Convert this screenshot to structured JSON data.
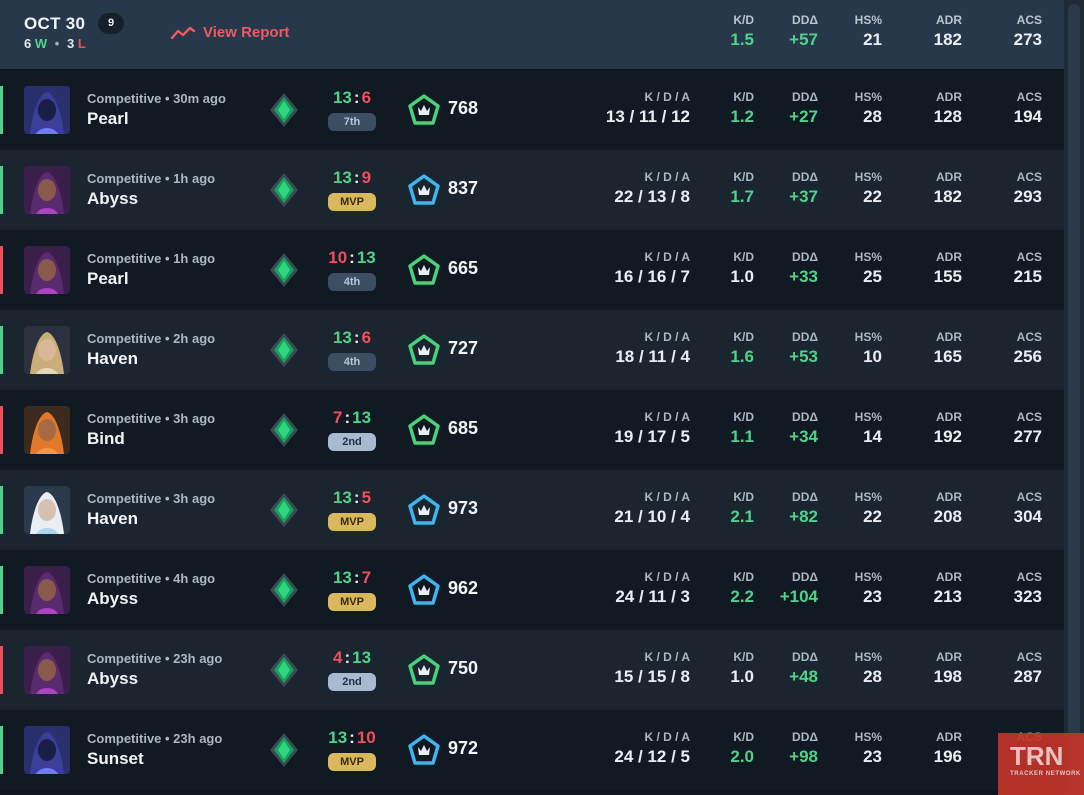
{
  "header": {
    "date": "OCT 30",
    "match_count": "9",
    "wins": "6",
    "wins_letter": "W",
    "losses": "3",
    "losses_letter": "L",
    "view_report": "View Report",
    "stats": [
      {
        "label": "K/D",
        "value": "1.5",
        "green": true
      },
      {
        "label": "DDΔ",
        "value": "+57",
        "green": true
      },
      {
        "label": "HS%",
        "value": "21",
        "green": false
      },
      {
        "label": "ADR",
        "value": "182",
        "green": false
      },
      {
        "label": "ACS",
        "value": "273",
        "green": false
      }
    ]
  },
  "column_labels": {
    "kda": "K / D / A",
    "kd": "K/D",
    "dd": "DDΔ",
    "hs": "HS%",
    "adr": "ADR",
    "acs": "ACS"
  },
  "matches": [
    {
      "result": "win",
      "agent": "omen-portrait",
      "meta": "Competitive • 30m ago",
      "map": "Pearl",
      "score_a": "13",
      "score_b": "6",
      "place": "7th",
      "place_style": "pos",
      "tier": "green",
      "rr": "768",
      "kda": "13 / 11 / 12",
      "kd": "1.2",
      "dd": "+27",
      "hs": "28",
      "adr": "128",
      "acs": "194"
    },
    {
      "result": "win",
      "agent": "reyna-portrait",
      "meta": "Competitive • 1h ago",
      "map": "Abyss",
      "score_a": "13",
      "score_b": "9",
      "place": "MVP",
      "place_style": "mvp",
      "tier": "blue",
      "rr": "837",
      "kda": "22 / 13 / 8",
      "kd": "1.7",
      "dd": "+37",
      "hs": "22",
      "adr": "182",
      "acs": "293"
    },
    {
      "result": "loss",
      "agent": "reyna-portrait",
      "meta": "Competitive • 1h ago",
      "map": "Pearl",
      "score_a": "10",
      "score_b": "13",
      "place": "4th",
      "place_style": "pos",
      "tier": "green",
      "rr": "665",
      "kda": "16 / 16 / 7",
      "kd": "1.0",
      "dd": "+33",
      "hs": "25",
      "adr": "155",
      "acs": "215"
    },
    {
      "result": "win",
      "agent": "chamber-portrait",
      "meta": "Competitive • 2h ago",
      "map": "Haven",
      "score_a": "13",
      "score_b": "6",
      "place": "4th",
      "place_style": "pos",
      "tier": "green",
      "rr": "727",
      "kda": "18 / 11 / 4",
      "kd": "1.6",
      "dd": "+53",
      "hs": "10",
      "adr": "165",
      "acs": "256"
    },
    {
      "result": "loss",
      "agent": "raze-portrait",
      "meta": "Competitive • 3h ago",
      "map": "Bind",
      "score_a": "7",
      "score_b": "13",
      "place": "2nd",
      "place_style": "pos2",
      "tier": "green",
      "rr": "685",
      "kda": "19 / 17 / 5",
      "kd": "1.1",
      "dd": "+34",
      "hs": "14",
      "adr": "192",
      "acs": "277"
    },
    {
      "result": "win",
      "agent": "jett-portrait",
      "meta": "Competitive • 3h ago",
      "map": "Haven",
      "score_a": "13",
      "score_b": "5",
      "place": "MVP",
      "place_style": "mvp",
      "tier": "blue",
      "rr": "973",
      "kda": "21 / 10 / 4",
      "kd": "2.1",
      "dd": "+82",
      "hs": "22",
      "adr": "208",
      "acs": "304"
    },
    {
      "result": "win",
      "agent": "reyna-portrait",
      "meta": "Competitive • 4h ago",
      "map": "Abyss",
      "score_a": "13",
      "score_b": "7",
      "place": "MVP",
      "place_style": "mvp",
      "tier": "blue",
      "rr": "962",
      "kda": "24 / 11 / 3",
      "kd": "2.2",
      "dd": "+104",
      "hs": "23",
      "adr": "213",
      "acs": "323"
    },
    {
      "result": "loss",
      "agent": "reyna-portrait",
      "meta": "Competitive • 23h ago",
      "map": "Abyss",
      "score_a": "4",
      "score_b": "13",
      "place": "2nd",
      "place_style": "pos2",
      "tier": "green",
      "rr": "750",
      "kda": "15 / 15 / 8",
      "kd": "1.0",
      "dd": "+48",
      "hs": "28",
      "adr": "198",
      "acs": "287"
    },
    {
      "result": "win",
      "agent": "omen-portrait",
      "meta": "Competitive • 23h ago",
      "map": "Sunset",
      "score_a": "13",
      "score_b": "10",
      "place": "MVP",
      "place_style": "mvp",
      "tier": "blue",
      "rr": "972",
      "kda": "24 / 12 / 5",
      "kd": "2.0",
      "dd": "+98",
      "hs": "23",
      "adr": "196",
      "acs": "…"
    }
  ],
  "watermark": {
    "big": "TRN",
    "small": "TRACKER NETWORK"
  },
  "colors": {
    "win": "#4fd38a",
    "loss": "#ef4f5c",
    "header_bg": "#27384a",
    "row_dark": "#111a23",
    "row_light": "#1a2530",
    "mvp": "#d9b85e",
    "accent_red": "#ef5a64"
  }
}
